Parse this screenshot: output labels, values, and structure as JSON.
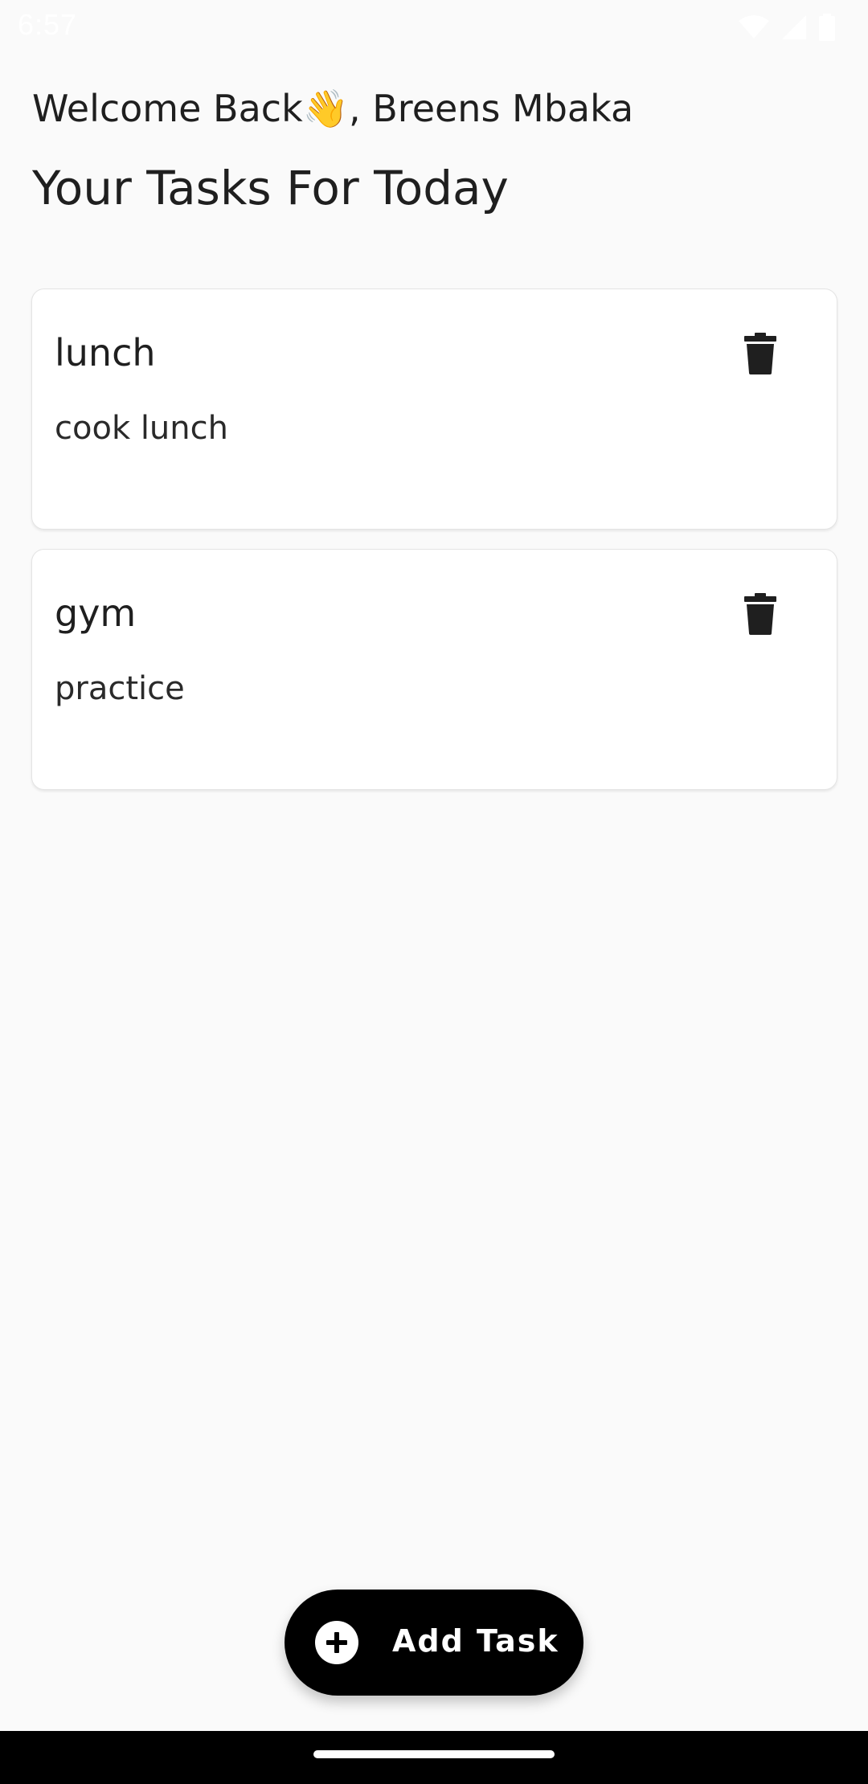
{
  "status_bar": {
    "time": "6:57",
    "icons": [
      "wifi-icon",
      "signal-icon",
      "battery-icon"
    ]
  },
  "header": {
    "welcome": "Welcome Back👋, Breens Mbaka",
    "title": "Your Tasks For Today"
  },
  "tasks": [
    {
      "title": "lunch",
      "description": "cook lunch"
    },
    {
      "title": "gym",
      "description": "practice"
    }
  ],
  "fab": {
    "label": "Add Task",
    "icon": "plus-circle-icon"
  },
  "colors": {
    "background": "#fafafa",
    "card": "#ffffff",
    "fab": "#000000",
    "nav_bar": "#000000"
  }
}
